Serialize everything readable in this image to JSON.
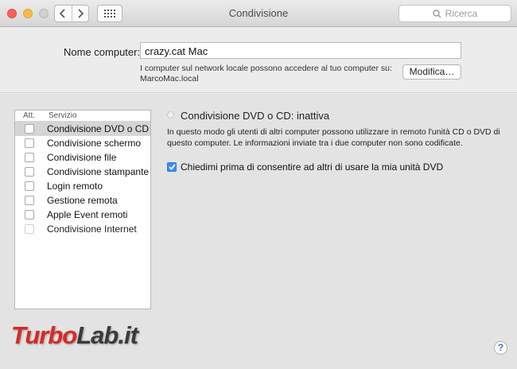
{
  "window": {
    "title": "Condivisione"
  },
  "search": {
    "placeholder": "Ricerca",
    "icon": "search-icon"
  },
  "computer_name": {
    "label": "Nome computer:",
    "value": "crazy.cat Mac",
    "info_line1": "I computer sul network locale possono accedere al tuo computer su:",
    "info_line2": "MarcoMac.local",
    "edit_button": "Modifica…"
  },
  "services": {
    "header_on": "Att.",
    "header_service": "Servizio",
    "items": [
      {
        "label": "Condivisione DVD o CD",
        "checked": false,
        "selected": true,
        "enabled": true
      },
      {
        "label": "Condivisione schermo",
        "checked": false,
        "selected": false,
        "enabled": true
      },
      {
        "label": "Condivisione file",
        "checked": false,
        "selected": false,
        "enabled": true
      },
      {
        "label": "Condivisione stampante",
        "checked": false,
        "selected": false,
        "enabled": true
      },
      {
        "label": "Login remoto",
        "checked": false,
        "selected": false,
        "enabled": true
      },
      {
        "label": "Gestione remota",
        "checked": false,
        "selected": false,
        "enabled": true
      },
      {
        "label": "Apple Event remoti",
        "checked": false,
        "selected": false,
        "enabled": true
      },
      {
        "label": "Condivisione Internet",
        "checked": false,
        "selected": false,
        "enabled": false
      }
    ]
  },
  "detail": {
    "status_title": "Condivisione DVD o CD: inattiva",
    "description": "In questo modo gli utenti di altri computer possono utilizzare in remoto l'unità CD o DVD di questo computer. Le informazioni inviate tra i due computer non sono codificate.",
    "ask_label": "Chiedimi prima di consentire ad altri di usare la mia unità DVD",
    "ask_checked": true
  },
  "help": {
    "label": "?"
  },
  "watermark": {
    "part1": "Turbo",
    "part2": "Lab.it"
  },
  "colors": {
    "accent": "#3d8cf5",
    "watermark_red": "#d62a26"
  }
}
